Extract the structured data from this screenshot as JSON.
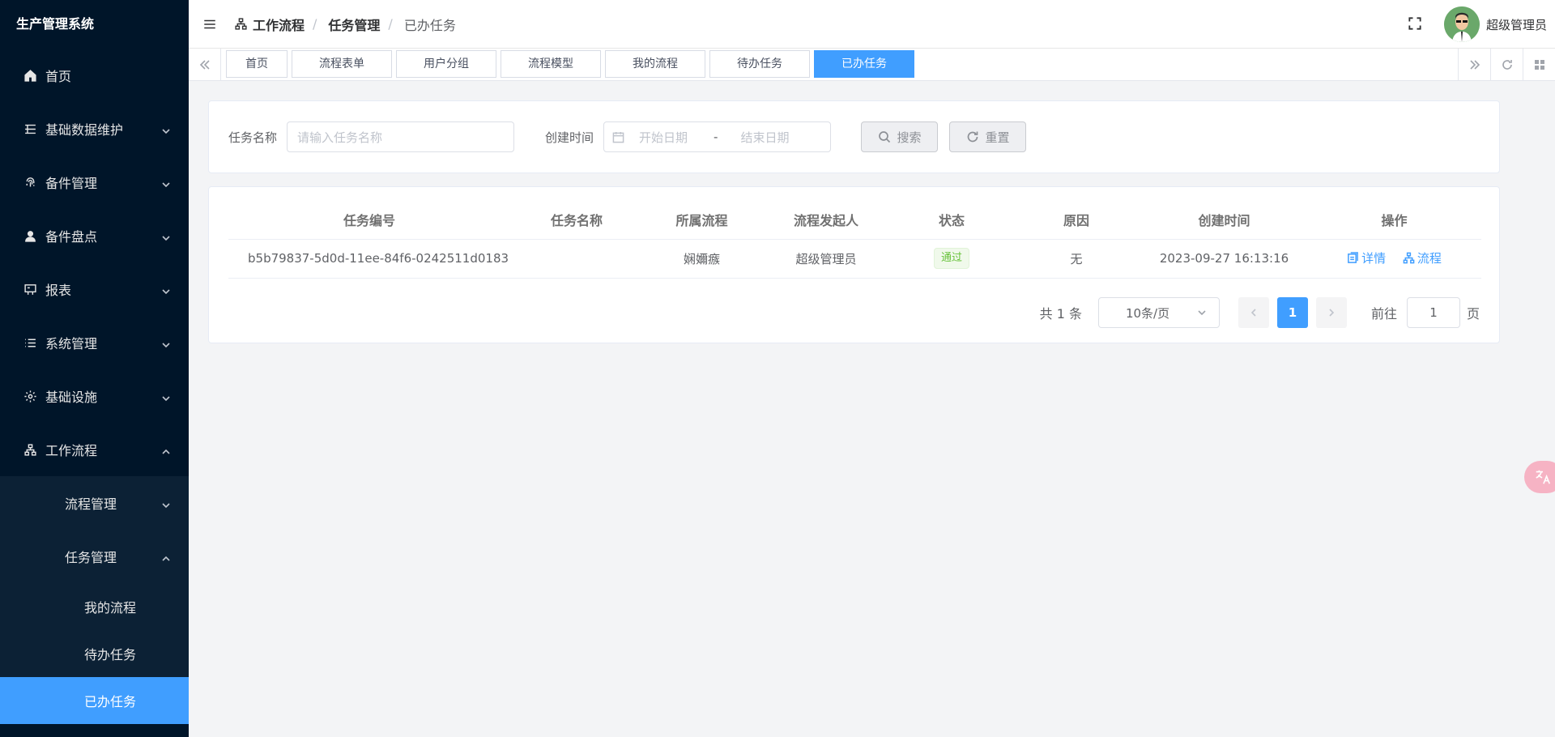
{
  "app": {
    "title": "生产管理系统"
  },
  "sidebar": {
    "items": [
      {
        "label": "首页",
        "icon": "home-icon"
      },
      {
        "label": "基础数据维护",
        "icon": "database-icon"
      },
      {
        "label": "备件管理",
        "icon": "fingerprint-icon"
      },
      {
        "label": "备件盘点",
        "icon": "user-icon"
      },
      {
        "label": "报表",
        "icon": "billboard-icon"
      },
      {
        "label": "系统管理",
        "icon": "list-icon"
      },
      {
        "label": "基础设施",
        "icon": "gear-icon"
      },
      {
        "label": "工作流程",
        "icon": "workflow-icon"
      }
    ],
    "workflow_children": [
      {
        "label": "流程管理"
      },
      {
        "label": "任务管理"
      }
    ],
    "task_children": [
      {
        "label": "我的流程"
      },
      {
        "label": "待办任务"
      },
      {
        "label": "已办任务"
      }
    ]
  },
  "header": {
    "breadcrumb": [
      "工作流程",
      "任务管理",
      "已办任务"
    ],
    "username": "超级管理员"
  },
  "tags": [
    "首页",
    "流程表单",
    "用户分组",
    "流程模型",
    "我的流程",
    "待办任务",
    "已办任务"
  ],
  "search": {
    "task_name_label": "任务名称",
    "task_name_placeholder": "请输入任务名称",
    "create_time_label": "创建时间",
    "start_placeholder": "开始日期",
    "range_separator": "-",
    "end_placeholder": "结束日期",
    "search_button": "搜索",
    "reset_button": "重置"
  },
  "table": {
    "columns": [
      "任务编号",
      "任务名称",
      "所属流程",
      "流程发起人",
      "状态",
      "原因",
      "创建时间",
      "操作"
    ],
    "rows": [
      {
        "id": "b5b79837-5d0d-11ee-84f6-0242511d0183",
        "name": "",
        "process": "娴嬭瘯",
        "initiator": "超级管理员",
        "status": "通过",
        "reason": "无",
        "created": "2023-09-27 16:13:16",
        "op_detail": "详情",
        "op_flow": "流程"
      }
    ]
  },
  "pagination": {
    "total": "共 1 条",
    "page_size": "10条/页",
    "current_page": "1",
    "goto_label": "前往",
    "goto_value": "1",
    "page_suffix": "页"
  },
  "colors": {
    "sidebar_bg": "#001529",
    "accent": "#409eff",
    "success": "#67c23a"
  }
}
